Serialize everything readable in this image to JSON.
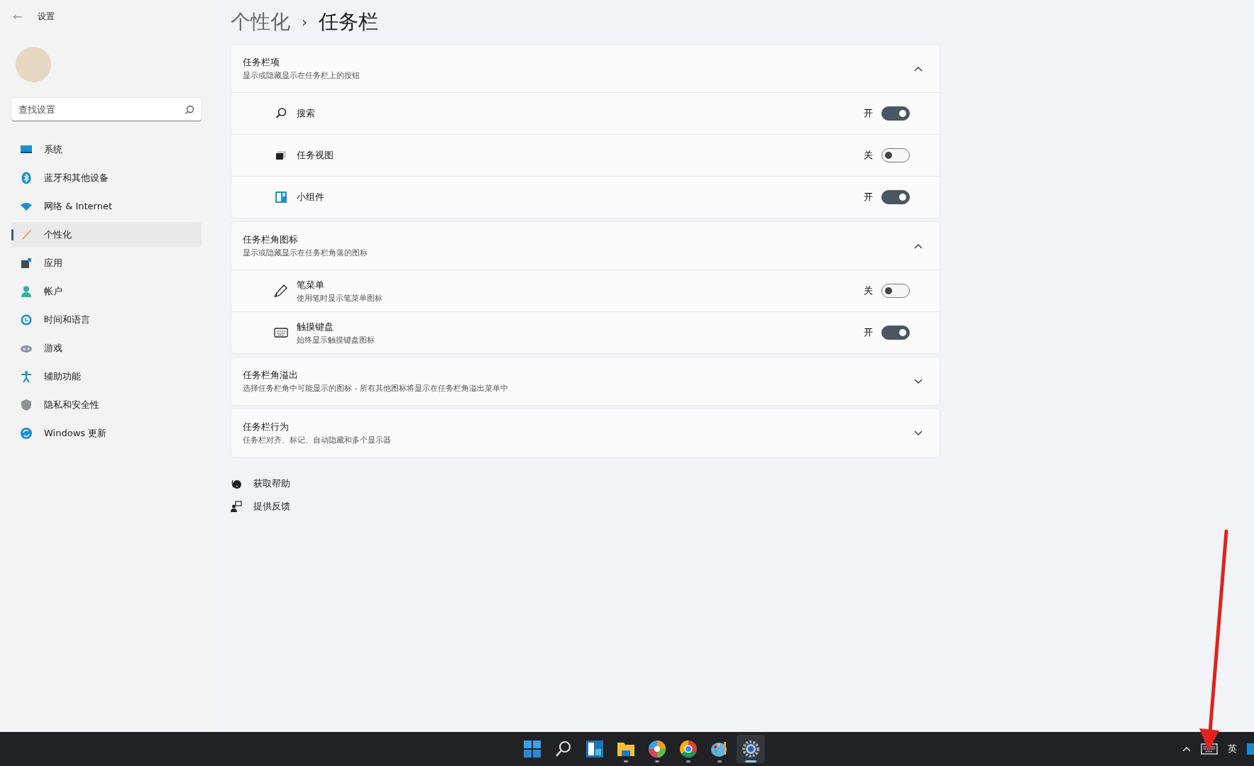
{
  "window": {
    "title": "设置",
    "back": "←"
  },
  "breadcrumb": {
    "parent": "个性化",
    "separator": "›",
    "current": "任务栏"
  },
  "search": {
    "placeholder": "查找设置"
  },
  "nav": [
    {
      "label": "系统",
      "kind": "system",
      "selected": false
    },
    {
      "label": "蓝牙和其他设备",
      "kind": "bluetooth",
      "selected": false
    },
    {
      "label": "网络 & Internet",
      "kind": "wifi",
      "selected": false
    },
    {
      "label": "个性化",
      "kind": "brush",
      "selected": true
    },
    {
      "label": "应用",
      "kind": "apps",
      "selected": false
    },
    {
      "label": "帐户",
      "kind": "account",
      "selected": false
    },
    {
      "label": "时间和语言",
      "kind": "time",
      "selected": false
    },
    {
      "label": "游戏",
      "kind": "game",
      "selected": false
    },
    {
      "label": "辅助功能",
      "kind": "access",
      "selected": false
    },
    {
      "label": "隐私和安全性",
      "kind": "shield",
      "selected": false
    },
    {
      "label": "Windows 更新",
      "kind": "update",
      "selected": false
    }
  ],
  "sections": [
    {
      "title": "任务栏项",
      "subtitle": "显示或隐藏显示在任务栏上的按钮",
      "expanded": true,
      "items": [
        {
          "label": "搜索",
          "kind": "search",
          "state_label": "开",
          "on": true
        },
        {
          "label": "任务视图",
          "kind": "taskview",
          "state_label": "关",
          "on": false
        },
        {
          "label": "小组件",
          "kind": "widgets",
          "state_label": "开",
          "on": true
        }
      ]
    },
    {
      "title": "任务栏角图标",
      "subtitle": "显示或隐藏显示在任务栏角落的图标",
      "expanded": true,
      "items": [
        {
          "label": "笔菜单",
          "description": "使用笔时显示笔菜单图标",
          "kind": "pen",
          "state_label": "关",
          "on": false
        },
        {
          "label": "触摸键盘",
          "description": "始终显示触摸键盘图标",
          "kind": "keyboard",
          "state_label": "开",
          "on": true
        }
      ]
    },
    {
      "title": "任务栏角溢出",
      "subtitle": "选择任务栏角中可能显示的图标 - 所有其他图标将显示在任务栏角溢出菜单中",
      "expanded": false
    },
    {
      "title": "任务栏行为",
      "subtitle": "任务栏对齐、标记、自动隐藏和多个显示器",
      "expanded": false
    }
  ],
  "links": [
    {
      "label": "获取帮助",
      "kind": "help"
    },
    {
      "label": "提供反馈",
      "kind": "feedback"
    }
  ],
  "taskbar": {
    "apps": [
      {
        "kind": "start",
        "running": false,
        "selected": false
      },
      {
        "kind": "search",
        "running": false,
        "selected": false
      },
      {
        "kind": "widgets",
        "running": false,
        "selected": false
      },
      {
        "kind": "folder",
        "running": true,
        "selected": false
      },
      {
        "kind": "pinwheel",
        "running": true,
        "selected": false
      },
      {
        "kind": "browser",
        "running": true,
        "selected": false
      },
      {
        "kind": "palette",
        "running": true,
        "selected": false
      },
      {
        "kind": "gear",
        "running": true,
        "selected": true
      }
    ],
    "tray": {
      "language": "英"
    }
  }
}
